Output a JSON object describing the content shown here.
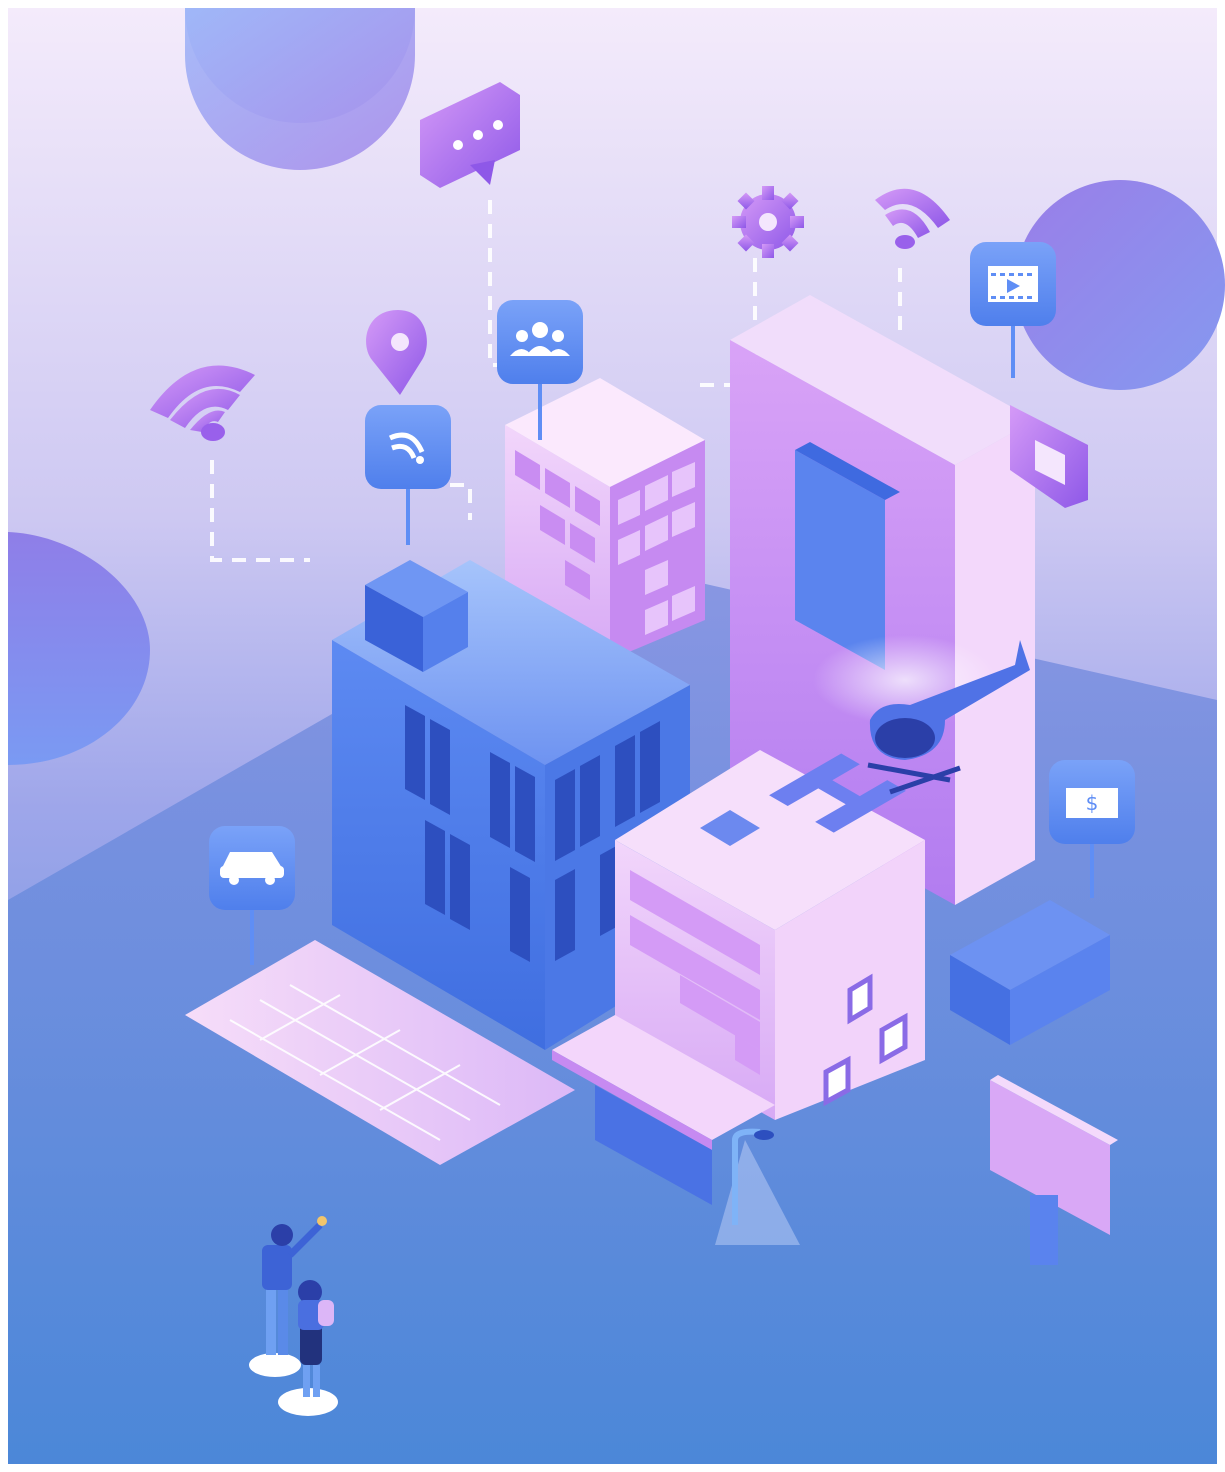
{
  "scene": {
    "palette": {
      "sky_top": "#f3e9fb",
      "sky_mid": "#b9bdf0",
      "ground": "#6f86de",
      "ground_bottom": "#4b86d8",
      "building_blue": "#5b86ef",
      "building_pink": "#f0c9f7",
      "building_purple": "#c98df2",
      "pin_blue": "#5f8ef5",
      "accent_purple": "#a56ef0"
    },
    "icons": [
      "wifi-icon",
      "location-pin-icon",
      "chat-bubble-icon",
      "group-icon",
      "gear-icon",
      "video-icon",
      "car-icon",
      "money-icon",
      "helicopter-icon",
      "helipad-icon",
      "billboard-icon",
      "street-lamp-icon",
      "parking-lot-icon"
    ],
    "helipad_letter": "H",
    "money_symbol": "$"
  }
}
